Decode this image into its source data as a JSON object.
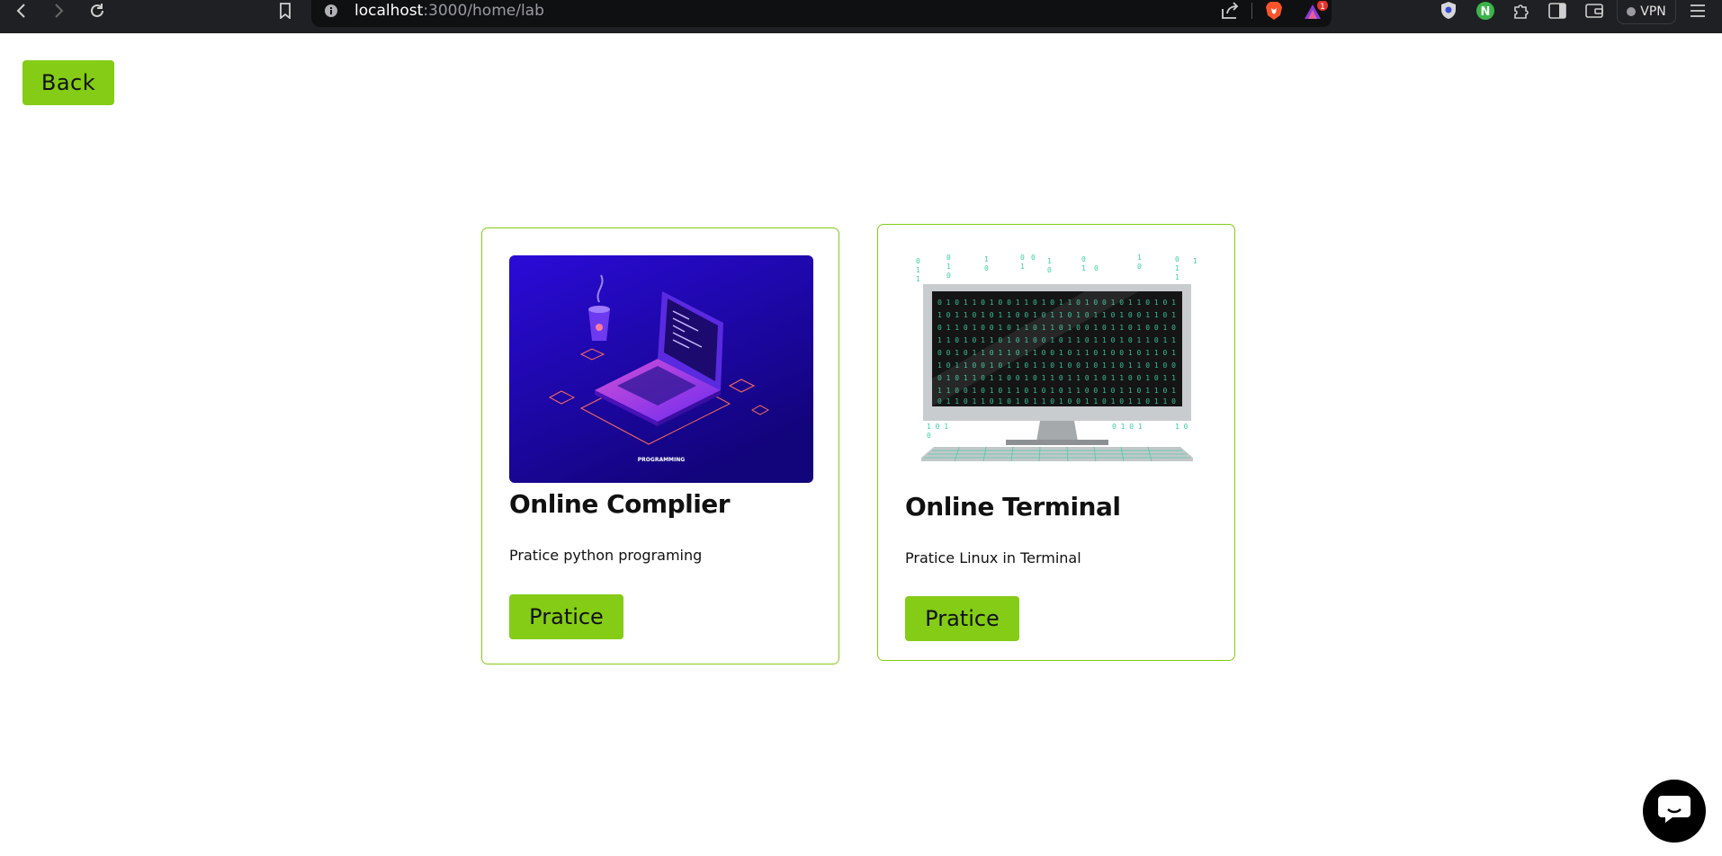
{
  "browser": {
    "url_host": "localhost",
    "url_rest": ":3000/home/lab",
    "rewards_badge": "1",
    "vpn_label": "VPN",
    "extension_badge": "N"
  },
  "page": {
    "back_label": "Back",
    "cards": [
      {
        "title": "Online Complier",
        "description": "Pratice python programing",
        "button_label": "Pratice",
        "image_caption": "PROGRAMMING"
      },
      {
        "title": "Online Terminal",
        "description": "Pratice Linux in Terminal",
        "button_label": "Pratice"
      }
    ]
  },
  "colors": {
    "accent": "#84cc16",
    "chrome_bg": "#1f2023",
    "laptop_bg_top": "#2a0bd8",
    "laptop_bg_bottom": "#12047a",
    "matrix_green": "#3ccfa3"
  }
}
